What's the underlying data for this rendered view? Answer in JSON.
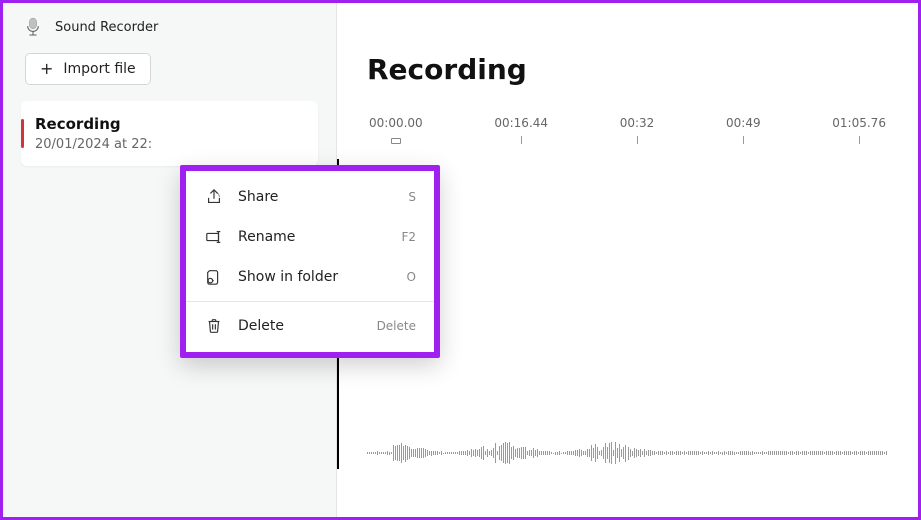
{
  "app": {
    "title": "Sound Recorder",
    "import_label": "Import file"
  },
  "recording_card": {
    "title": "Recording",
    "subtitle": "20/01/2024 at 22:"
  },
  "main": {
    "title": "Recording",
    "ticks": [
      "00:00.00",
      "00:16.44",
      "00:32",
      "00:49",
      "01:05.76"
    ]
  },
  "context_menu": {
    "items": [
      {
        "icon": "share-icon",
        "label": "Share",
        "shortcut": "S"
      },
      {
        "icon": "rename-icon",
        "label": "Rename",
        "shortcut": "F2"
      },
      {
        "icon": "folder-icon",
        "label": "Show in folder",
        "shortcut": "O"
      },
      {
        "icon": "trash-icon",
        "label": "Delete",
        "shortcut": "Delete"
      }
    ]
  }
}
